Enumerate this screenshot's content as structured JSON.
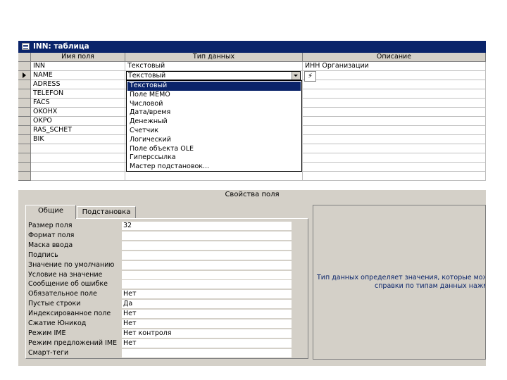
{
  "window": {
    "title": "INN: таблица"
  },
  "grid": {
    "headers": {
      "field_name": "Имя поля",
      "data_type": "Тип данных",
      "description": "Описание"
    },
    "rows": [
      {
        "name": "INN",
        "type": "Текстовый",
        "desc": "ИНН Организации"
      },
      {
        "name": "NAME",
        "type": "",
        "desc": ""
      },
      {
        "name": "ADRESS",
        "type": "",
        "desc": ""
      },
      {
        "name": "TELEFON",
        "type": "",
        "desc": ""
      },
      {
        "name": "FACS",
        "type": "",
        "desc": ""
      },
      {
        "name": "OKOHX",
        "type": "",
        "desc": ""
      },
      {
        "name": "OKPO",
        "type": "",
        "desc": ""
      },
      {
        "name": "RAS_SCHET",
        "type": "",
        "desc": ""
      },
      {
        "name": "BIK",
        "type": "",
        "desc": ""
      }
    ],
    "combo_value": "Текстовый",
    "builder_icon": "builder-wand-icon"
  },
  "dropdown": {
    "items": [
      "Текстовый",
      "Поле MEMO",
      "Числовой",
      "Дата/время",
      "Денежный",
      "Счетчик",
      "Логический",
      "Поле объекта OLE",
      "Гиперссылка",
      "Мастер подстановок..."
    ],
    "selected_index": 0
  },
  "properties": {
    "bar_title": "Свойства поля",
    "tabs": [
      "Общие",
      "Подстановка"
    ],
    "rows": [
      {
        "label": "Размер поля",
        "value": "32"
      },
      {
        "label": "Формат поля",
        "value": ""
      },
      {
        "label": "Маска ввода",
        "value": ""
      },
      {
        "label": "Подпись",
        "value": ""
      },
      {
        "label": "Значение по умолчанию",
        "value": ""
      },
      {
        "label": "Условие на значение",
        "value": ""
      },
      {
        "label": "Сообщение об ошибке",
        "value": ""
      },
      {
        "label": "Обязательное поле",
        "value": "Нет"
      },
      {
        "label": "Пустые строки",
        "value": "Да"
      },
      {
        "label": "Индексированное поле",
        "value": "Нет"
      },
      {
        "label": "Сжатие Юникод",
        "value": "Нет"
      },
      {
        "label": "Режим IME",
        "value": "Нет контроля"
      },
      {
        "label": "Режим предложений IME",
        "value": "Нет"
      },
      {
        "label": "Смарт-теги",
        "value": ""
      }
    ],
    "help_line1": "Тип данных определяет значения, которые можно",
    "help_line2": "справки по типам данных нажмите"
  },
  "colors": {
    "titlebar": "#0a246a",
    "face": "#d4d0c8",
    "help_text": "#0a246a"
  }
}
